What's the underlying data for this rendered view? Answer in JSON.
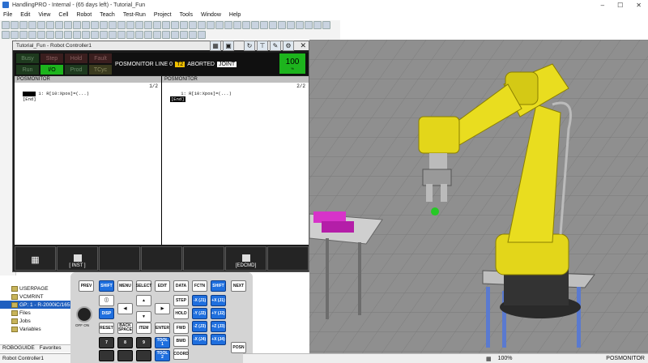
{
  "window": {
    "title": "HandlingPRO - Internal - (65 days left) - Tutorial_Fun"
  },
  "menu": [
    "File",
    "Edit",
    "View",
    "Cell",
    "Robot",
    "Teach",
    "Test-Run",
    "Project",
    "Tools",
    "Window",
    "Help"
  ],
  "pendant": {
    "title": "Tutorial_Fun - Robot Controller1",
    "leds": [
      {
        "label": "Busy",
        "state": "off"
      },
      {
        "label": "Step",
        "state": "off2"
      },
      {
        "label": "Hold",
        "state": "off2"
      },
      {
        "label": "Fault",
        "state": "off2"
      },
      {
        "label": "Run",
        "state": "off"
      },
      {
        "label": "I/O",
        "state": "on"
      },
      {
        "label": "Prod",
        "state": "off"
      },
      {
        "label": "TCyc",
        "state": "off3"
      }
    ],
    "program": "POSMONITOR LINE 0",
    "mode": "T2",
    "status": "ABORTED",
    "coord": "JOINT",
    "override": "100",
    "override_unit": "%",
    "screens": [
      {
        "header": "POSMONITOR",
        "page": "1/2",
        "line1": "1:  R[10:Xpos]=(...)",
        "end": "[End]"
      },
      {
        "header": "POSMONITOR",
        "page": "2/2",
        "line1": "1:  R[10:Xpos]=(...)",
        "end": "[End]"
      }
    ],
    "fkeys": [
      "",
      "[ INST ]",
      "",
      "",
      "",
      "[EDCMD]",
      ""
    ]
  },
  "teach_pendant": {
    "keys": {
      "prev": "PREV",
      "shift_l": "SHIFT",
      "menu": "MENU",
      "select": "SELECT",
      "edit": "EDIT",
      "data": "DATA",
      "fctn": "FCTN",
      "shift_r": "SHIFT",
      "next": "NEXT",
      "disp": "DISP",
      "step": "STEP",
      "hold": "HOLD",
      "reset": "RESET",
      "backspace": "BACK SPACE",
      "item": "ITEM",
      "enter": "ENTER",
      "fwd": "FWD",
      "bwd": "BWD",
      "coord": "COORD",
      "tool1": "TOOL 1",
      "tool2": "TOOL 2",
      "posn": "POSN",
      "jx_minus": "-X (J1)",
      "jx_plus": "+X (J1)",
      "jy_minus": "-Y (J2)",
      "jy_plus": "+Y (J2)",
      "jz_minus": "-Z (J3)",
      "jz_plus": "+Z (J3)",
      "jx2_minus": "-X (J4)",
      "jx2_plus": "+X (J4)",
      "n7": "7",
      "n8": "8",
      "n9": "9"
    },
    "estop_label": "OFF ON"
  },
  "tree": {
    "items": [
      {
        "label": "USERPAGE"
      },
      {
        "label": "VCMRINT"
      },
      {
        "label": "GP: 1 - R-2000iC/165F",
        "selected": true
      },
      {
        "label": "Files"
      },
      {
        "label": "Jobs"
      },
      {
        "label": "Variables"
      }
    ],
    "tabs": [
      "ROBOGUIDE",
      "Favorites"
    ],
    "footer": "Robot Controller1"
  },
  "status": {
    "zoom": "100%",
    "mode": "POSMONITOR"
  }
}
